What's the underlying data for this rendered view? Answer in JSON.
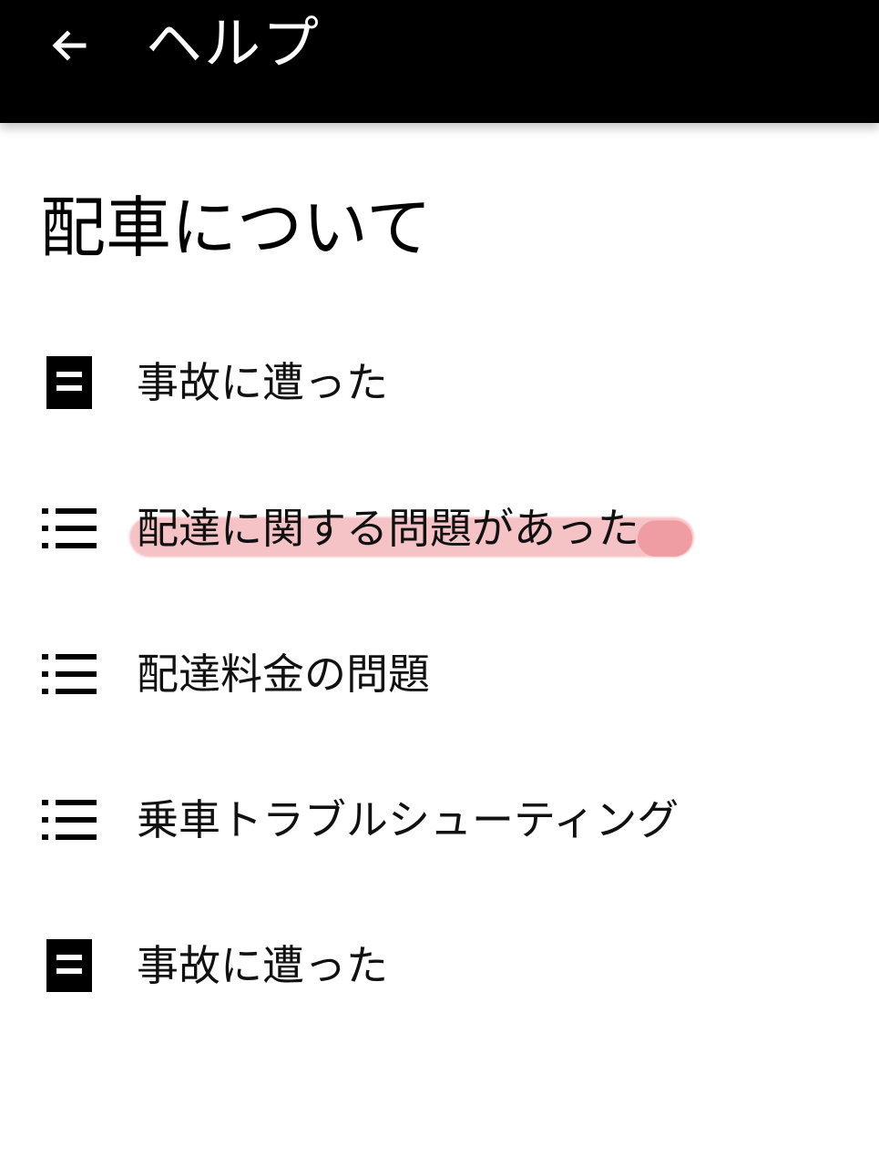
{
  "appbar": {
    "title": "ヘルプ",
    "back_icon": "arrow-left-icon"
  },
  "section": {
    "title": "配車について"
  },
  "items": [
    {
      "label": "事故に遭った",
      "icon": "article-icon",
      "highlighted": false
    },
    {
      "label": "配達に関する問題があった",
      "icon": "list-icon",
      "highlighted": true
    },
    {
      "label": "配達料金の問題",
      "icon": "list-icon",
      "highlighted": false
    },
    {
      "label": "乗車トラブルシューティング",
      "icon": "list-icon",
      "highlighted": false
    },
    {
      "label": "事故に遭った",
      "icon": "article-icon",
      "highlighted": false
    }
  ],
  "colors": {
    "appbar_bg": "#000000",
    "highlight": "#e86e78"
  }
}
